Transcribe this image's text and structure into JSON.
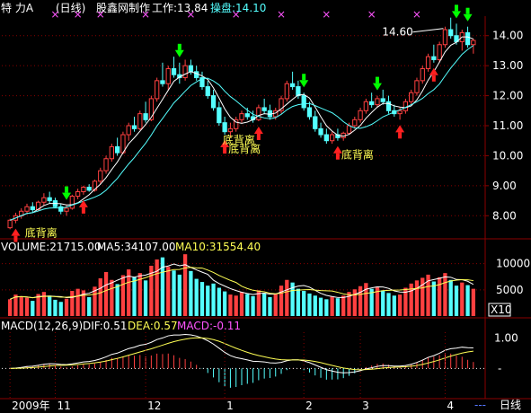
{
  "header": {
    "stock_name": "特  力A",
    "period": "(日线)",
    "producer": "股鑫网制作",
    "work_label": "工作:13.84",
    "panel_label": "操盘:14.10"
  },
  "colors": {
    "up": "#ff4040",
    "down": "#54ffff",
    "ma_white": "#ffffff",
    "ma_cyan": "#54ffff",
    "yellow": "#ffff54",
    "magenta": "#ff54ff",
    "grid": "#8b0000",
    "green_arrow": "#00ff00",
    "red_arrow": "#ff2020"
  },
  "price_panel": {
    "y_ticks": [
      "14.00",
      "13.00",
      "12.00",
      "11.00",
      "10.00",
      "9.00",
      "8.00"
    ],
    "y_range": [
      7.35,
      14.65
    ],
    "peak_label": "14.60",
    "annotations": [
      "底背离",
      "底背离",
      "底背离",
      "底背离"
    ],
    "buy_arrow_count": 7,
    "sell_arrow_count": 6
  },
  "volume_panel": {
    "label": "VOLUME:21715.00",
    "ma5_label": "MA5:34107.00",
    "ma10_label": "MA10:31554.40",
    "y_ticks": [
      "10000",
      "5000"
    ],
    "scale_label": "X10"
  },
  "macd_panel": {
    "label": "MACD(12,26,9)",
    "dif_label": "DIF:0.51",
    "dea_label": "DEA:0.57",
    "macd_label": "MACD:-0.11",
    "y_ticks": [
      "1.00",
      "-"
    ]
  },
  "x_axis": {
    "labels": [
      "2009年",
      "11",
      "12",
      "1",
      "2",
      "3",
      "4"
    ],
    "end_marker": "---",
    "tab_label": "日线"
  },
  "chart_data": [
    {
      "type": "candlestick",
      "title": "特力A (日线)",
      "y_range": [
        7.35,
        14.65
      ],
      "ohlc": [
        [
          7.6,
          7.9,
          7.55,
          7.85
        ],
        [
          7.85,
          8.1,
          7.75,
          8.0
        ],
        [
          8.0,
          8.25,
          7.9,
          8.15
        ],
        [
          8.15,
          8.4,
          8.05,
          8.3
        ],
        [
          8.3,
          8.45,
          8.1,
          8.2
        ],
        [
          8.2,
          8.5,
          8.15,
          8.45
        ],
        [
          8.45,
          8.75,
          8.35,
          8.6
        ],
        [
          8.6,
          8.8,
          8.4,
          8.5
        ],
        [
          8.5,
          8.6,
          8.25,
          8.3
        ],
        [
          8.3,
          8.4,
          8.05,
          8.15
        ],
        [
          8.15,
          8.35,
          8.0,
          8.25
        ],
        [
          8.25,
          8.7,
          8.2,
          8.65
        ],
        [
          8.65,
          8.9,
          8.55,
          8.8
        ],
        [
          8.8,
          9.0,
          8.7,
          8.95
        ],
        [
          8.95,
          9.05,
          8.8,
          8.85
        ],
        [
          8.85,
          9.2,
          8.8,
          9.15
        ],
        [
          9.15,
          9.6,
          9.05,
          9.5
        ],
        [
          9.5,
          10.0,
          9.4,
          9.9
        ],
        [
          9.9,
          10.4,
          9.8,
          10.3
        ],
        [
          10.3,
          10.6,
          10.0,
          10.1
        ],
        [
          10.1,
          10.8,
          10.05,
          10.7
        ],
        [
          10.7,
          11.1,
          10.5,
          11.0
        ],
        [
          11.0,
          11.3,
          10.8,
          10.9
        ],
        [
          10.9,
          11.5,
          10.85,
          11.4
        ],
        [
          11.4,
          11.8,
          11.1,
          11.2
        ],
        [
          11.2,
          12.0,
          11.15,
          11.9
        ],
        [
          11.9,
          12.6,
          11.8,
          12.5
        ],
        [
          12.5,
          13.1,
          12.3,
          12.4
        ],
        [
          12.4,
          13.0,
          12.2,
          12.9
        ],
        [
          12.9,
          13.3,
          12.6,
          12.7
        ],
        [
          12.7,
          13.1,
          12.4,
          12.6
        ],
        [
          12.6,
          13.2,
          12.5,
          13.0
        ],
        [
          13.0,
          13.2,
          12.7,
          12.8
        ],
        [
          12.8,
          13.0,
          12.5,
          12.6
        ],
        [
          12.6,
          12.8,
          12.2,
          12.3
        ],
        [
          12.3,
          12.5,
          11.9,
          12.0
        ],
        [
          12.0,
          12.2,
          11.5,
          11.6
        ],
        [
          11.6,
          11.8,
          11.0,
          11.1
        ],
        [
          11.1,
          11.3,
          10.7,
          10.8
        ],
        [
          10.8,
          11.1,
          10.6,
          10.9
        ],
        [
          10.9,
          11.3,
          10.8,
          11.2
        ],
        [
          11.2,
          11.5,
          11.1,
          11.4
        ],
        [
          11.4,
          11.6,
          11.2,
          11.3
        ],
        [
          11.3,
          11.5,
          11.1,
          11.2
        ],
        [
          11.2,
          11.7,
          11.15,
          11.6
        ],
        [
          11.6,
          11.9,
          11.4,
          11.5
        ],
        [
          11.5,
          11.7,
          11.2,
          11.3
        ],
        [
          11.3,
          11.6,
          11.2,
          11.5
        ],
        [
          11.5,
          12.0,
          11.4,
          11.9
        ],
        [
          11.9,
          12.5,
          11.8,
          12.4
        ],
        [
          12.4,
          12.8,
          12.2,
          12.3
        ],
        [
          12.3,
          12.5,
          11.9,
          12.0
        ],
        [
          12.0,
          12.1,
          11.5,
          11.6
        ],
        [
          11.6,
          11.8,
          11.2,
          11.3
        ],
        [
          11.3,
          11.5,
          10.8,
          10.9
        ],
        [
          10.9,
          11.1,
          10.6,
          10.7
        ],
        [
          10.7,
          10.9,
          10.4,
          10.5
        ],
        [
          10.5,
          10.8,
          10.4,
          10.7
        ],
        [
          10.7,
          10.9,
          10.5,
          10.6
        ],
        [
          10.6,
          10.8,
          10.5,
          10.75
        ],
        [
          10.75,
          11.1,
          10.7,
          11.0
        ],
        [
          11.0,
          11.3,
          10.9,
          11.2
        ],
        [
          11.2,
          11.6,
          11.1,
          11.5
        ],
        [
          11.5,
          11.9,
          11.4,
          11.8
        ],
        [
          11.8,
          12.1,
          11.6,
          11.7
        ],
        [
          11.7,
          12.0,
          11.6,
          11.9
        ],
        [
          11.9,
          12.2,
          11.7,
          11.8
        ],
        [
          11.8,
          12.0,
          11.4,
          11.5
        ],
        [
          11.5,
          11.7,
          11.3,
          11.4
        ],
        [
          11.4,
          11.6,
          11.2,
          11.5
        ],
        [
          11.5,
          11.9,
          11.4,
          11.8
        ],
        [
          11.8,
          12.2,
          11.7,
          12.1
        ],
        [
          12.1,
          12.6,
          12.0,
          12.5
        ],
        [
          12.5,
          13.0,
          12.4,
          12.9
        ],
        [
          12.9,
          13.4,
          12.8,
          13.3
        ],
        [
          13.3,
          13.7,
          13.1,
          13.2
        ],
        [
          13.2,
          13.8,
          13.1,
          13.7
        ],
        [
          13.7,
          14.3,
          13.6,
          14.2
        ],
        [
          14.2,
          14.6,
          13.9,
          14.0
        ],
        [
          14.0,
          14.4,
          13.7,
          13.8
        ],
        [
          13.8,
          14.2,
          13.5,
          14.1
        ],
        [
          14.1,
          14.3,
          13.6,
          13.7
        ],
        [
          13.7,
          13.9,
          13.4,
          13.84
        ]
      ],
      "volume": [
        3200,
        4100,
        3800,
        3500,
        2900,
        4200,
        4600,
        3900,
        3100,
        2700,
        3300,
        4800,
        5200,
        4900,
        3600,
        5600,
        7200,
        8400,
        6900,
        6100,
        7800,
        8900,
        7400,
        8200,
        6800,
        9600,
        10800,
        11200,
        9400,
        8700,
        7900,
        11800,
        8600,
        7100,
        6500,
        5800,
        6200,
        5400,
        4700,
        4100,
        3900,
        4600,
        4200,
        3800,
        4900,
        4400,
        3600,
        4300,
        5800,
        6900,
        6400,
        5200,
        4800,
        4300,
        3900,
        3500,
        3200,
        3700,
        3400,
        3900,
        4600,
        5100,
        5700,
        6300,
        5200,
        5600,
        4900,
        4400,
        3900,
        4100,
        5400,
        6200,
        6800,
        7300,
        7900,
        6600,
        7400,
        8200,
        6900,
        5800,
        6400,
        5900,
        5200
      ],
      "ma5_volume_latest": 34107.0,
      "ma10_volume_latest": 31554.4,
      "volume_latest": 21715.0,
      "macd": {
        "dif": 0.51,
        "dea": 0.57,
        "macd": -0.11
      }
    }
  ]
}
